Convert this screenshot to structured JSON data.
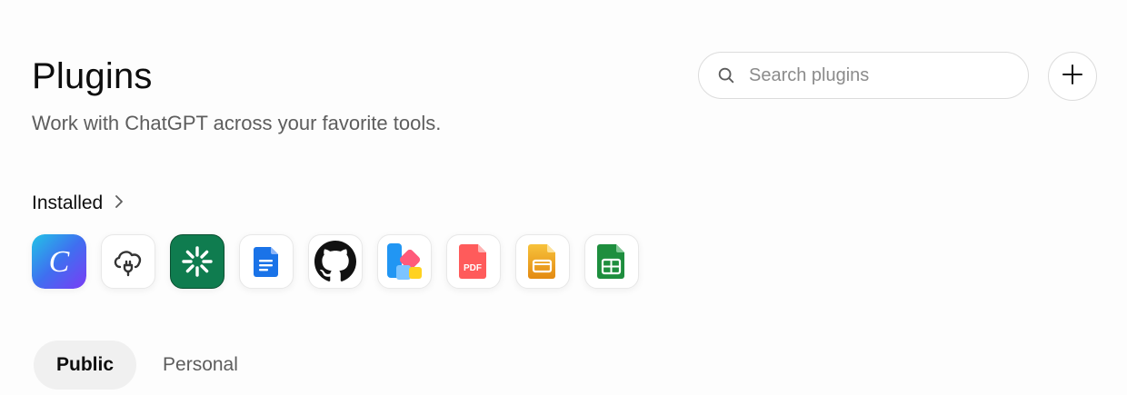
{
  "header": {
    "title": "Plugins",
    "subtitle": "Work with ChatGPT across your favorite tools."
  },
  "search": {
    "placeholder": "Search plugins",
    "value": "",
    "icon": "search-icon"
  },
  "add_button": {
    "icon": "plus-icon"
  },
  "installed": {
    "label": "Installed",
    "chevron_icon": "chevron-right-icon",
    "apps": [
      {
        "name": "canva",
        "icon": "canva-icon",
        "colors": [
          "#22c3e6",
          "#7a3cf5"
        ]
      },
      {
        "name": "cloud-plugin",
        "icon": "cloud-plug-icon",
        "colors": [
          "#333333"
        ]
      },
      {
        "name": "green-spark",
        "icon": "green-spark-icon",
        "colors": [
          "#0f7c4f"
        ]
      },
      {
        "name": "docs",
        "icon": "doc-icon",
        "colors": [
          "#1a73e8"
        ]
      },
      {
        "name": "github",
        "icon": "github-icon",
        "colors": [
          "#111111"
        ]
      },
      {
        "name": "design-blocks",
        "icon": "blocks-icon",
        "colors": [
          "#2196f3",
          "#ff5a7a",
          "#ffd21f"
        ]
      },
      {
        "name": "pdf",
        "icon": "pdf-icon",
        "colors": [
          "#ff5b5b"
        ]
      },
      {
        "name": "slides",
        "icon": "slides-icon",
        "colors": [
          "#f4a31b"
        ]
      },
      {
        "name": "sheets",
        "icon": "sheets-icon",
        "colors": [
          "#1e8e3e"
        ]
      }
    ]
  },
  "tabs": [
    {
      "label": "Public",
      "active": true
    },
    {
      "label": "Personal",
      "active": false
    }
  ]
}
